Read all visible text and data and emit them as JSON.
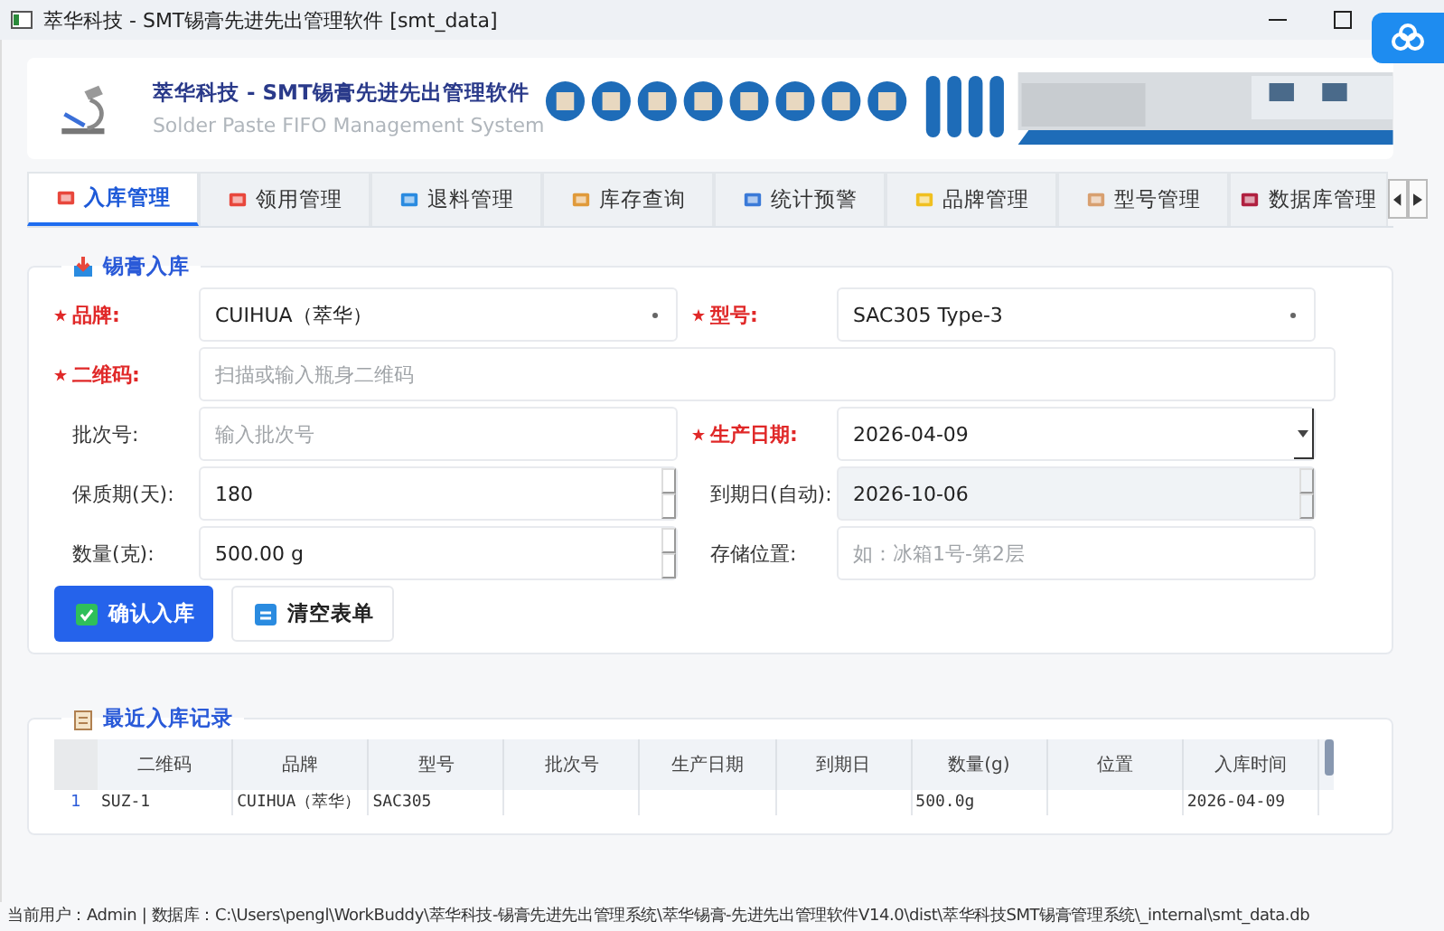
{
  "window": {
    "title": "萃华科技 - SMT锡膏先进先出管理软件 [smt_data]"
  },
  "header": {
    "title": "萃华科技 - SMT锡膏先进先出管理软件",
    "subtitle": "Solder Paste FIFO Management System"
  },
  "tabs": [
    {
      "label": "入库管理",
      "selected": true
    },
    {
      "label": "领用管理",
      "selected": false
    },
    {
      "label": "退料管理",
      "selected": false
    },
    {
      "label": "库存查询",
      "selected": false
    },
    {
      "label": "统计预警",
      "selected": false
    },
    {
      "label": "品牌管理",
      "selected": false
    },
    {
      "label": "型号管理",
      "selected": false
    },
    {
      "label": "数据库管理",
      "selected": false
    }
  ],
  "form": {
    "title": "锡膏入库",
    "rows": [
      [
        {
          "label": "品牌:",
          "required": true,
          "kind": "select",
          "value": "CUIHUA（萃华）"
        },
        {
          "label": "型号:",
          "required": true,
          "kind": "select",
          "value": "SAC305 Type-3"
        }
      ],
      [
        {
          "label": "二维码:",
          "required": true,
          "kind": "text",
          "placeholder": "扫描或输入瓶身二维码"
        }
      ],
      [
        {
          "label": "批次号:",
          "required": false,
          "kind": "text",
          "placeholder": "输入批次号"
        },
        {
          "label": "生产日期:",
          "required": true,
          "kind": "date",
          "value": "2026-04-09"
        }
      ],
      [
        {
          "label": "保质期(天):",
          "required": false,
          "kind": "spin",
          "value": "180"
        },
        {
          "label": "到期日(自动):",
          "required": false,
          "kind": "spin",
          "value": "2026-10-06",
          "readonly": true
        }
      ],
      [
        {
          "label": "数量(克):",
          "required": false,
          "kind": "spin",
          "value": "500.00 g"
        },
        {
          "label": "存储位置:",
          "required": false,
          "kind": "text",
          "placeholder": "如：冰箱1号-第2层"
        }
      ]
    ],
    "buttons": [
      {
        "label": "确认入库",
        "kind": "primary"
      },
      {
        "label": "清空表单",
        "kind": "secondary"
      }
    ]
  },
  "records": {
    "title": "最近入库记录",
    "columns": [
      "二维码",
      "品牌",
      "型号",
      "批次号",
      "生产日期",
      "到期日",
      "数量(g)",
      "位置",
      "入库时间"
    ],
    "rows": [
      {
        "number": "1",
        "cells": [
          {
            "text": "SUZ-1"
          },
          {
            "text": "CUIHUA（萃华）"
          },
          {
            "text": "SAC305"
          },
          {
            "empty": true
          },
          {
            "empty": true
          },
          {
            "empty": true
          },
          {
            "text": "500.0g"
          },
          {
            "empty": true
          },
          {
            "text": "2026-04-09"
          }
        ]
      }
    ]
  },
  "status_bar": "当前用户：Admin | 数据库：C:\\Users\\pengl\\WorkBuddy\\萃华科技-锡膏先进先出管理系统\\萃华锡膏-先进先出管理软件V14.0\\dist\\萃华科技SMT锡膏管理系统\\_internal\\smt_data.db"
}
